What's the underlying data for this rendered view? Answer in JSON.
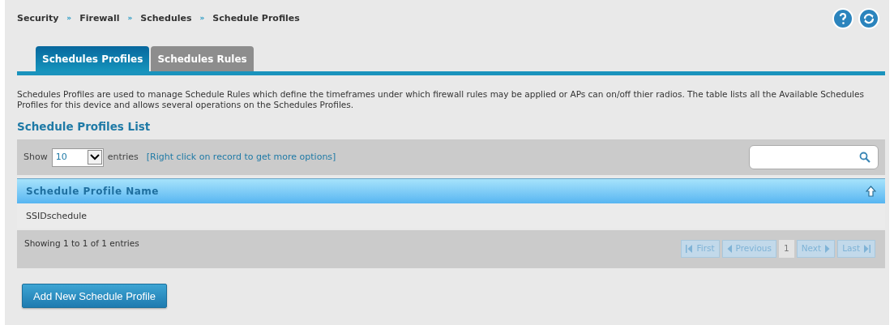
{
  "breadcrumb": [
    "Security",
    "Firewall",
    "Schedules",
    "Schedule Profiles"
  ],
  "breadcrumb_separator": "»",
  "tabs": [
    {
      "label": "Schedules Profiles",
      "selected": true
    },
    {
      "label": "Schedules Rules",
      "selected": false
    }
  ],
  "description": "Schedules Profiles are used to manage Schedule Rules which define the timeframes under which firewall rules may be applied or APs can on/off thier radios. The table lists all the Available Schedules Profiles for this device and allows several operations on the Schedules Profiles.",
  "section_title": "Schedule Profiles List",
  "toolbar": {
    "show_label": "Show",
    "page_size": "10",
    "entries_label": "entries",
    "hint": "[Right click on record to get more options]"
  },
  "table": {
    "columns": [
      "Schedule Profile Name"
    ],
    "rows": [
      [
        "SSIDschedule"
      ]
    ]
  },
  "footer": {
    "info": "Showing 1 to 1 of 1 entries",
    "pager": [
      {
        "kind": "first",
        "label": "First",
        "disabled": true
      },
      {
        "kind": "previous",
        "label": "Previous",
        "disabled": true
      },
      {
        "kind": "page",
        "label": "1",
        "selected": true
      },
      {
        "kind": "next",
        "label": "Next",
        "disabled": true
      },
      {
        "kind": "last",
        "label": "Last",
        "disabled": true
      }
    ]
  },
  "add_button": "Add New Schedule Profile"
}
